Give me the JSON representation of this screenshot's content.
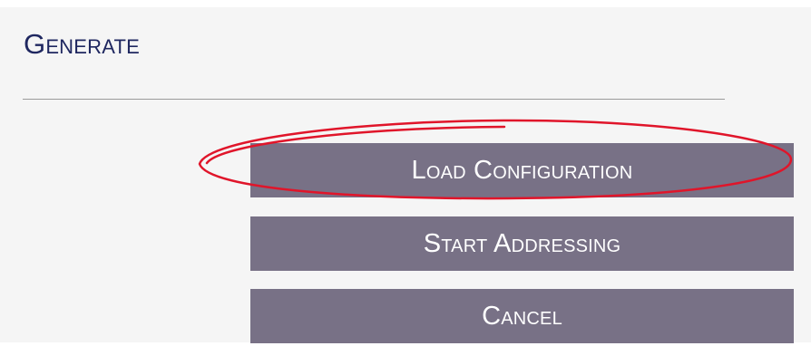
{
  "panel": {
    "title": "Generate"
  },
  "actions": {
    "load_configuration": "Load Configuration",
    "start_addressing": "Start Addressing",
    "cancel": "Cancel"
  },
  "colors": {
    "panel_background": "#f5f5f5",
    "title_text": "#1f2760",
    "button_background": "#787186",
    "button_text": "#ffffff",
    "highlight_outline": "#e0152a"
  }
}
